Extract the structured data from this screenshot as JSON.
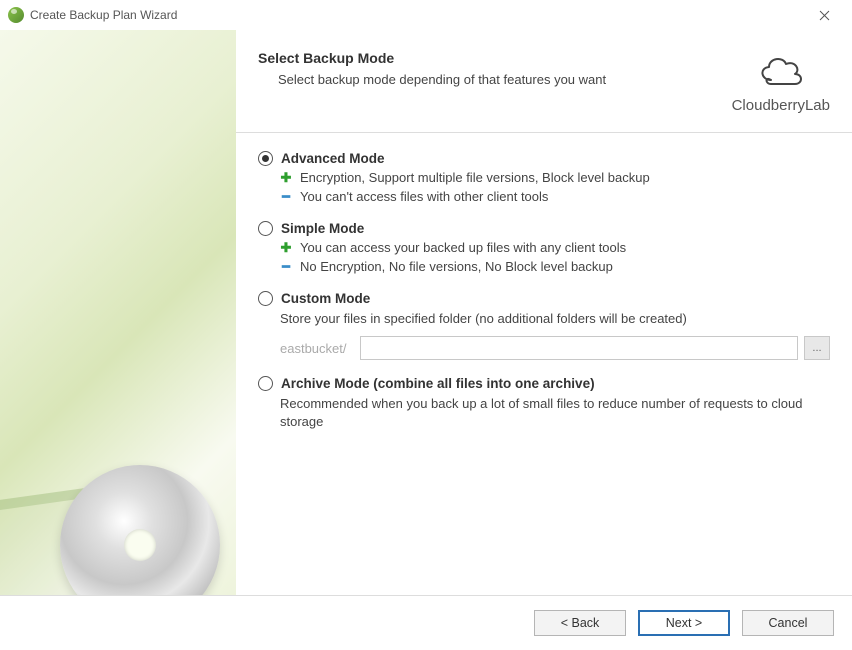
{
  "window": {
    "title": "Create Backup Plan Wizard"
  },
  "brand": {
    "name": "CloudberryLab"
  },
  "header": {
    "title": "Select Backup Mode",
    "subtitle": "Select backup mode depending of that features you want"
  },
  "modes": {
    "advanced": {
      "label": "Advanced Mode",
      "selected": true,
      "pro": "Encryption, Support multiple file versions, Block level backup",
      "con": "You can't access files with other client tools"
    },
    "simple": {
      "label": "Simple Mode",
      "selected": false,
      "pro": "You can access your backed up files with any client tools",
      "con": "No Encryption, No file versions, No Block level backup"
    },
    "custom": {
      "label": "Custom Mode",
      "selected": false,
      "desc": "Store your files in specified folder (no additional folders will be created)",
      "path_prefix": "eastbucket/",
      "path_value": "",
      "browse_label": "..."
    },
    "archive": {
      "label": "Archive Mode (combine all files into one archive)",
      "selected": false,
      "desc": "Recommended when you back up a lot of small files to reduce number of requests to cloud storage"
    }
  },
  "footer": {
    "back": "< Back",
    "next": "Next >",
    "cancel": "Cancel"
  }
}
